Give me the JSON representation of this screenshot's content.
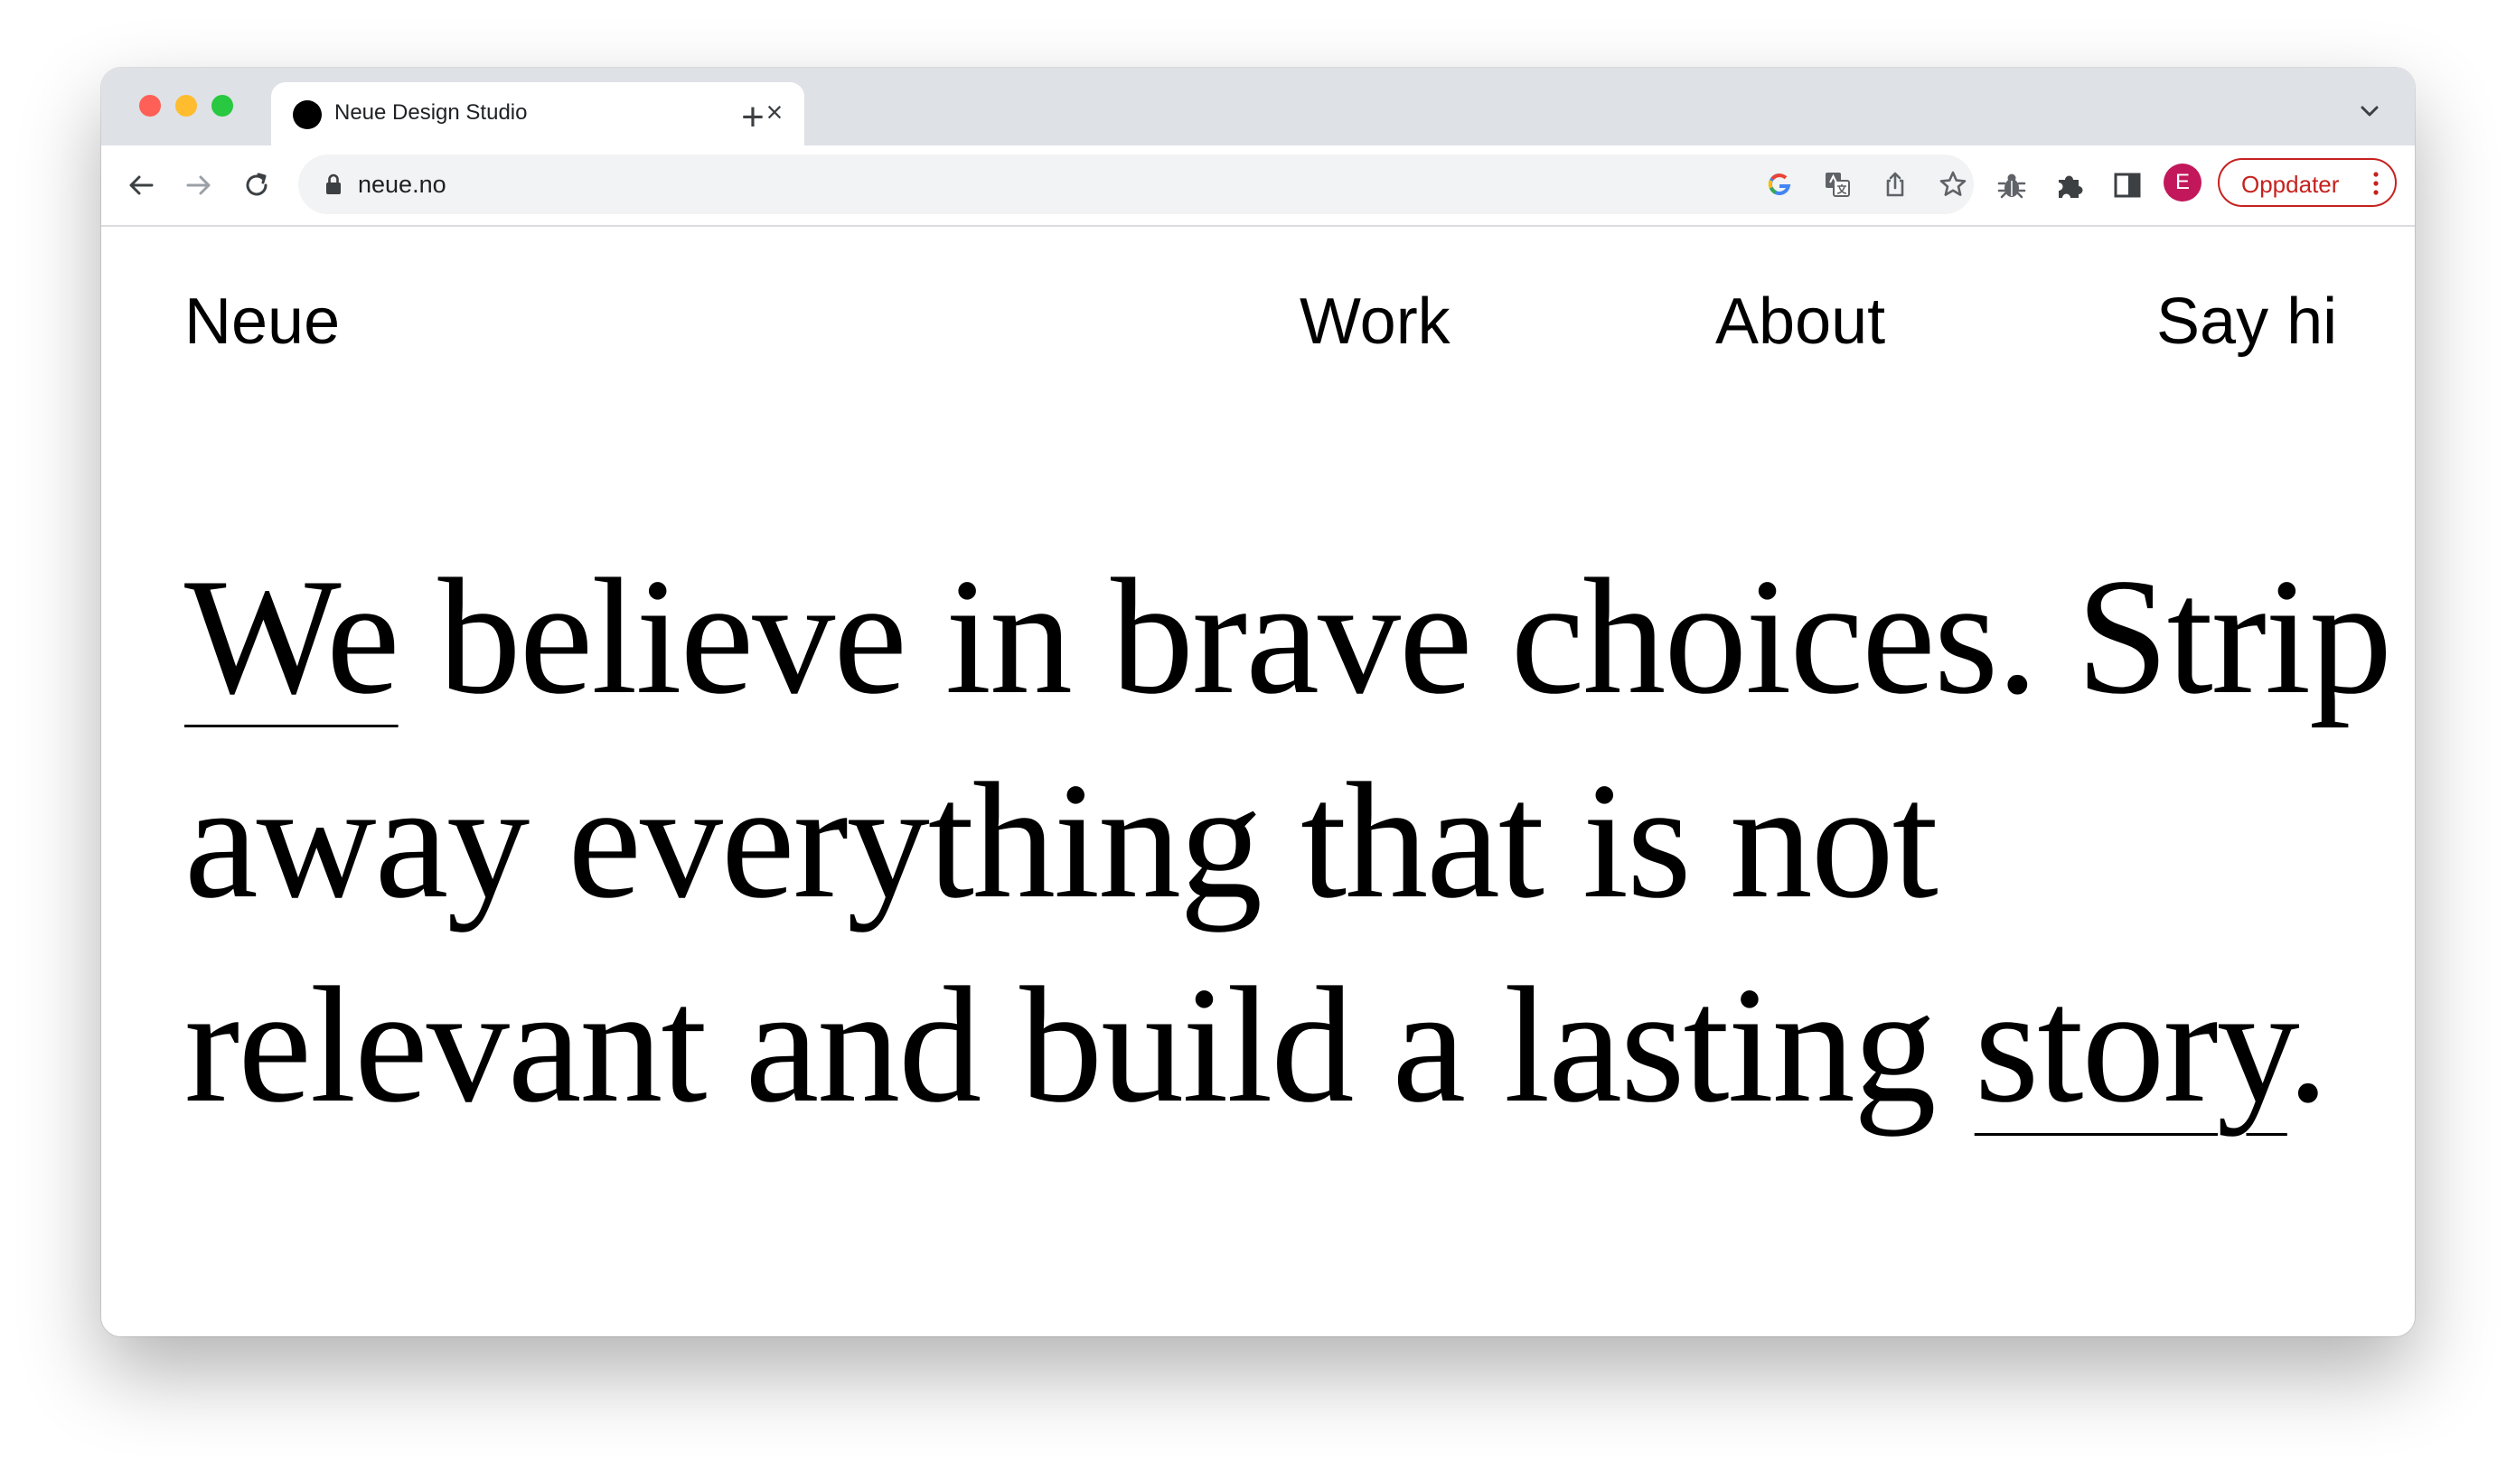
{
  "browser": {
    "tab": {
      "title": "Neue Design Studio"
    },
    "address_bar": {
      "url": "neue.no"
    },
    "profile_initial": "E",
    "update_button": {
      "label": "Oppdater"
    }
  },
  "icons": {
    "back": "arrow-left-icon",
    "forward": "arrow-right-icon",
    "reload": "reload-icon",
    "lock": "lock-icon",
    "google": "google-icon",
    "translate": "translate-icon",
    "share": "share-icon",
    "bookmark": "star-icon",
    "extension_bug": "bug-icon",
    "extensions": "puzzle-icon",
    "side_panel": "side-panel-icon"
  },
  "colors": {
    "update_accent": "#c5221f",
    "avatar": "#c2185b"
  },
  "site": {
    "logo": "Neue",
    "nav": {
      "work": "Work",
      "about": "About",
      "say_hi": "Say hi"
    },
    "hero": {
      "line1_lead": "We",
      "line1_rest": " believe in brave choices. Strip",
      "line2": "away everything that is not",
      "line3_rest": "relevant and build a lasting ",
      "line3_link": "story",
      "line3_end": "."
    }
  }
}
